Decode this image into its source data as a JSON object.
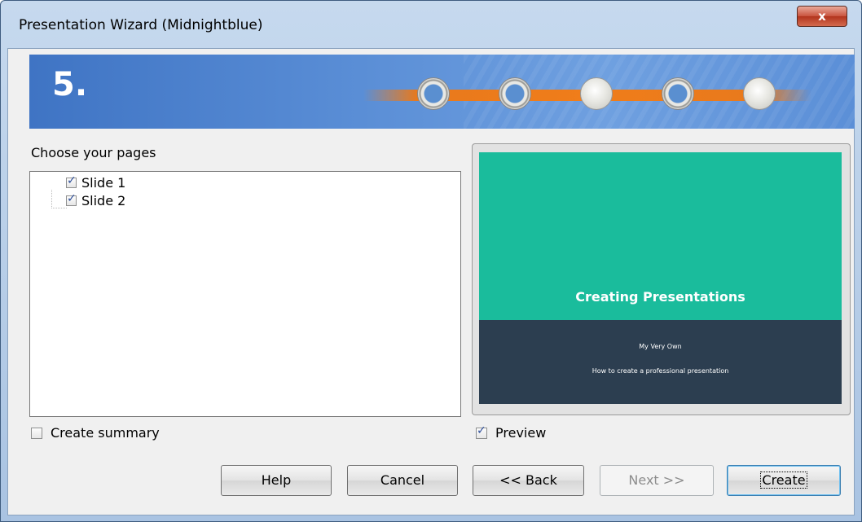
{
  "window": {
    "title": "Presentation Wizard (Midnightblue)",
    "close_glyph": "x"
  },
  "banner": {
    "step_number": "5.",
    "steps": [
      {
        "state": "active"
      },
      {
        "state": "active"
      },
      {
        "state": "inactive"
      },
      {
        "state": "active"
      },
      {
        "state": "inactive"
      }
    ]
  },
  "pages": {
    "label": "Choose your pages",
    "items": [
      {
        "label": "Slide 1",
        "checked": true
      },
      {
        "label": "Slide 2",
        "checked": true
      }
    ]
  },
  "preview": {
    "slide_title": "Creating Presentations",
    "slide_subtitle_1": "My Very Own",
    "slide_subtitle_2": "How to create a professional presentation",
    "colors": {
      "top": "#1abc9c",
      "bottom": "#2c3e50"
    }
  },
  "options": {
    "create_summary_label": "Create summary",
    "create_summary_checked": false,
    "preview_label": "Preview",
    "preview_checked": true
  },
  "buttons": {
    "help": "Help",
    "cancel": "Cancel",
    "back": "<< Back",
    "next": "Next >>",
    "create": "Create"
  }
}
